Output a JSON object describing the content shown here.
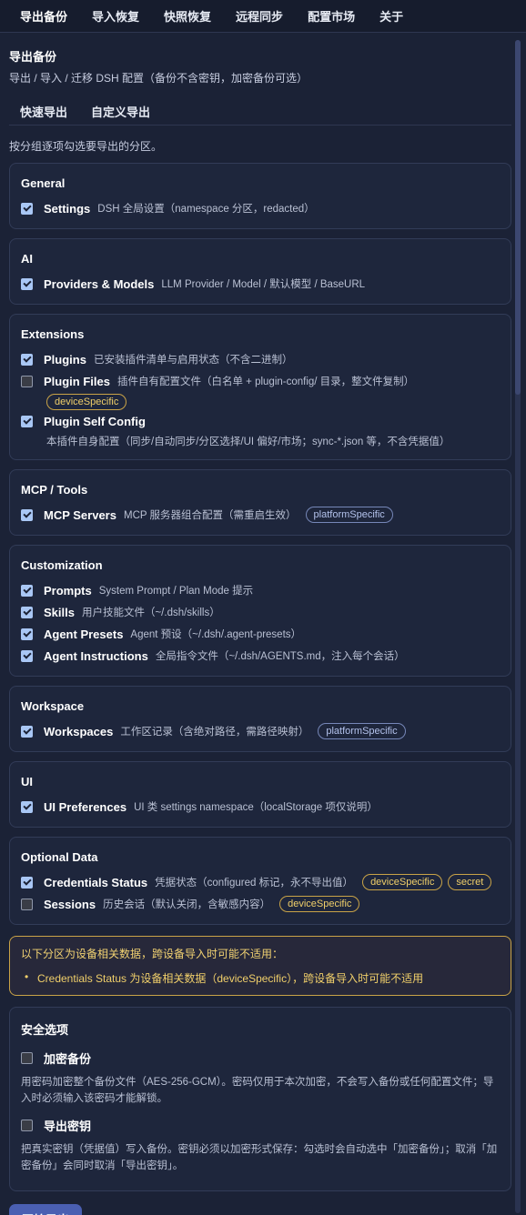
{
  "nav": {
    "tabs": [
      "导出备份",
      "导入恢复",
      "快照恢复",
      "远程同步",
      "配置市场",
      "关于"
    ]
  },
  "page": {
    "title": "导出备份",
    "subtitle": "导出 / 导入 / 迁移 DSH 配置（备份不含密钥，加密备份可选）",
    "subtabs": [
      "快速导出",
      "自定义导出"
    ],
    "hint": "按分组逐项勾选要导出的分区。"
  },
  "groups": [
    {
      "title": "General",
      "items": [
        {
          "name": "Settings",
          "desc": "DSH 全局设置（namespace 分区，redacted）",
          "checked": true
        }
      ]
    },
    {
      "title": "AI",
      "items": [
        {
          "name": "Providers & Models",
          "desc": "LLM Provider / Model / 默认模型 / BaseURL",
          "checked": true
        }
      ]
    },
    {
      "title": "Extensions",
      "items": [
        {
          "name": "Plugins",
          "desc": "已安装插件清单与启用状态（不含二进制）",
          "checked": true
        },
        {
          "name": "Plugin Files",
          "desc": "插件自有配置文件（白名单 + plugin-config/ 目录，整文件复制）",
          "checked": false,
          "badge": "deviceSpecific"
        },
        {
          "name": "Plugin Self Config",
          "desc": "本插件自身配置（同步/自动同步/分区选择/UI 偏好/市场；sync-*.json 等，不含凭据值）",
          "checked": true
        }
      ]
    },
    {
      "title": "MCP / Tools",
      "items": [
        {
          "name": "MCP Servers",
          "desc": "MCP 服务器组合配置（需重启生效）",
          "checked": true,
          "badge": "platformSpecific"
        }
      ]
    },
    {
      "title": "Customization",
      "items": [
        {
          "name": "Prompts",
          "desc": "System Prompt / Plan Mode 提示",
          "checked": true
        },
        {
          "name": "Skills",
          "desc": "用户技能文件（~/.dsh/skills）",
          "checked": true
        },
        {
          "name": "Agent Presets",
          "desc": "Agent 预设（~/.dsh/.agent-presets）",
          "checked": true
        },
        {
          "name": "Agent Instructions",
          "desc": "全局指令文件（~/.dsh/AGENTS.md，注入每个会话）",
          "checked": true
        }
      ]
    },
    {
      "title": "Workspace",
      "items": [
        {
          "name": "Workspaces",
          "desc": "工作区记录（含绝对路径，需路径映射）",
          "checked": true,
          "badge": "platformSpecific"
        }
      ]
    },
    {
      "title": "UI",
      "items": [
        {
          "name": "UI Preferences",
          "desc": "UI 类 settings namespace（localStorage 项仅说明）",
          "checked": true
        }
      ]
    },
    {
      "title": "Optional Data",
      "items": [
        {
          "name": "Credentials Status",
          "desc": "凭据状态（configured 标记，永不导出值）",
          "checked": true,
          "badge": "deviceSpecific",
          "badge2": "secret"
        },
        {
          "name": "Sessions",
          "desc": "历史会话（默认关闭，含敏感内容）",
          "checked": false,
          "badge": "deviceSpecific"
        }
      ]
    }
  ],
  "warning": {
    "title": "以下分区为设备相关数据，跨设备导入时可能不适用：",
    "items": [
      "Credentials Status 为设备相关数据（deviceSpecific），跨设备导入时可能不适用"
    ]
  },
  "security": {
    "title": "安全选项",
    "encrypt_label": "加密备份",
    "encrypt_checked": false,
    "encrypt_desc": "用密码加密整个备份文件（AES-256-GCM）。密码仅用于本次加密，不会写入备份或任何配置文件；导入时必须输入该密码才能解锁。",
    "export_key_label": "导出密钥",
    "export_key_checked": false,
    "export_key_desc": "把真实密钥（凭据值）写入备份。密钥必须以加密形式保存：勾选时会自动选中「加密备份」；取消「加密备份」会同时取消「导出密钥」。"
  },
  "actions": {
    "start_label": "开始导出"
  }
}
